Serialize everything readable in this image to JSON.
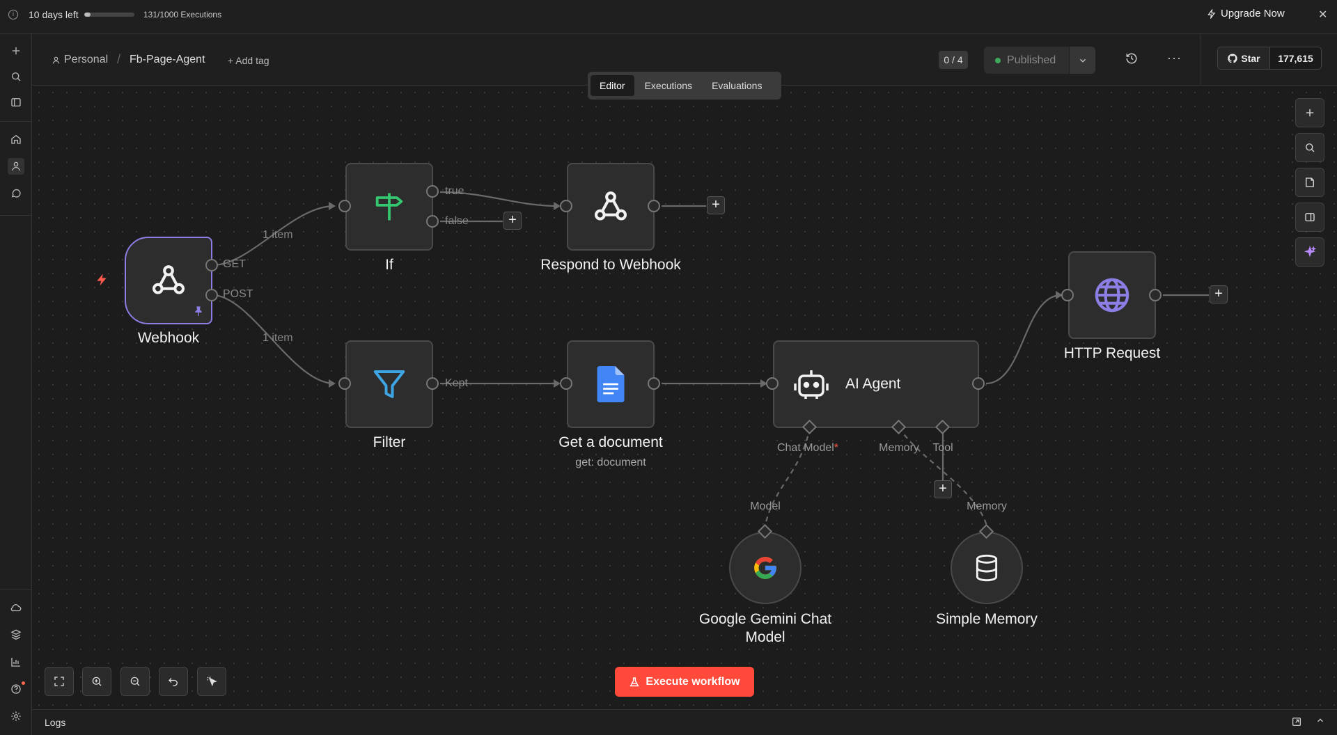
{
  "banner": {
    "days_left": "10 days left",
    "usage_fraction": 0.131,
    "executions": "131/1000 Executions",
    "upgrade": "Upgrade Now"
  },
  "header": {
    "project": "Personal",
    "workflow_name": "Fb-Page-Agent",
    "add_tag": "+ Add tag",
    "counter": "0 / 4",
    "publish_label": "Published",
    "github_star": "Star",
    "github_count": "177,615"
  },
  "tabs": [
    {
      "label": "Editor",
      "active": true
    },
    {
      "label": "Executions",
      "active": false
    },
    {
      "label": "Evaluations",
      "active": false
    }
  ],
  "nodes": {
    "webhook": {
      "title": "Webhook",
      "icon": "webhook-icon"
    },
    "if": {
      "title": "If",
      "icon": "signpost-icon"
    },
    "respond": {
      "title": "Respond to Webhook",
      "icon": "webhook-icon"
    },
    "filter": {
      "title": "Filter",
      "icon": "filter-icon"
    },
    "getdoc": {
      "title": "Get a document",
      "subtitle": "get: document",
      "icon": "google-docs-icon"
    },
    "agent": {
      "title": "AI Agent",
      "icon": "robot-icon"
    },
    "http": {
      "title": "HTTP Request",
      "icon": "globe-icon"
    },
    "gemini": {
      "title_line1": "Google Gemini Chat",
      "title_line2": "Model",
      "icon": "google-icon"
    },
    "memory": {
      "title": "Simple Memory",
      "icon": "database-icon"
    }
  },
  "edge_labels": {
    "get": "GET",
    "post": "POST",
    "item_top": "1 item",
    "item_bottom": "1 item",
    "true": "true",
    "false": "false",
    "kept": "Kept"
  },
  "connections": {
    "chat_model": "Chat Model",
    "required_mark": "*",
    "memory": "Memory",
    "tool": "Tool",
    "model": "Model",
    "memory_in": "Memory"
  },
  "execute_label": "Execute workflow",
  "logs_label": "Logs",
  "colors": {
    "accent_red": "#ff4a3b",
    "trigger_border": "#8b7fe6",
    "if_green": "#35c76f",
    "filter_blue": "#3fa6e6",
    "globe_purple": "#8b7fe6",
    "published_dot": "#3fa85b"
  }
}
